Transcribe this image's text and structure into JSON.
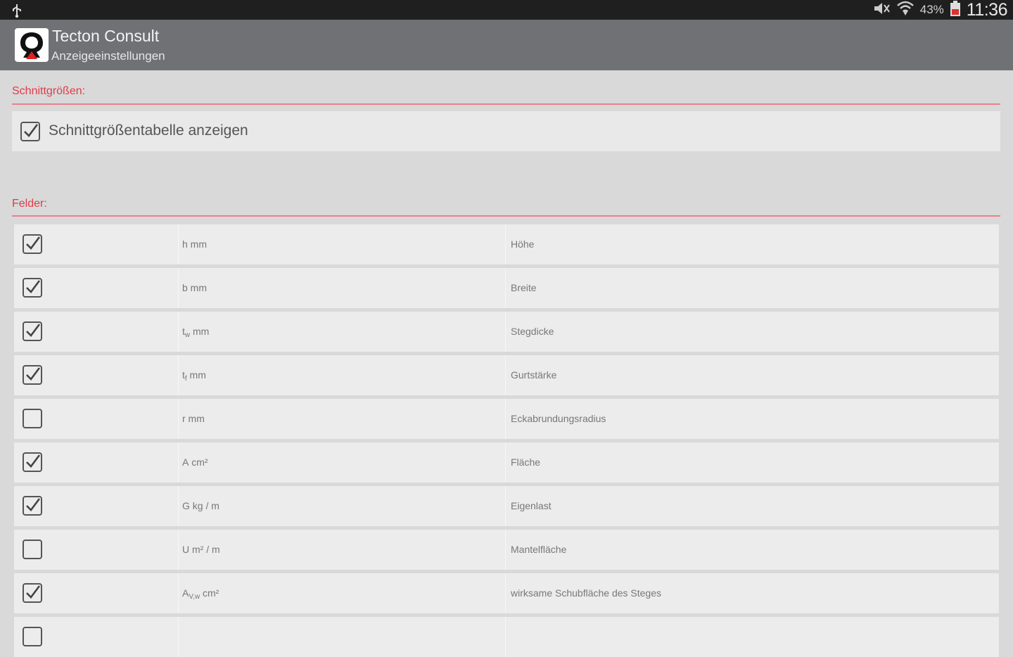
{
  "status_bar": {
    "battery_percent": "43%",
    "time": "11:36",
    "icons": [
      "usb-icon",
      "mute-icon",
      "wifi-icon",
      "battery-icon"
    ]
  },
  "action_bar": {
    "app_title": "Tecton Consult",
    "subtitle": "Anzeigeeinstellungen",
    "logo_icon": "tecton-logo-icon"
  },
  "section1": {
    "title": "Schnittgrößen:",
    "option": {
      "label": "Schnittgrößentabelle anzeigen",
      "checked": true
    }
  },
  "section2": {
    "title": "Felder:",
    "rows": [
      {
        "checked": true,
        "sym_main": "h",
        "sym_sub": "",
        "unit": " mm",
        "desc": "Höhe"
      },
      {
        "checked": true,
        "sym_main": "b",
        "sym_sub": "",
        "unit": " mm",
        "desc": "Breite"
      },
      {
        "checked": true,
        "sym_main": "t",
        "sym_sub": "w",
        "unit": " mm",
        "desc": "Stegdicke"
      },
      {
        "checked": true,
        "sym_main": "t",
        "sym_sub": "f",
        "unit": " mm",
        "desc": "Gurtstärke"
      },
      {
        "checked": false,
        "sym_main": "r",
        "sym_sub": "",
        "unit": " mm",
        "desc": "Eckabrundungsradius"
      },
      {
        "checked": true,
        "sym_main": "A",
        "sym_sub": "",
        "unit": " cm²",
        "desc": "Fläche"
      },
      {
        "checked": true,
        "sym_main": "G",
        "sym_sub": "",
        "unit": " kg / m",
        "desc": "Eigenlast"
      },
      {
        "checked": false,
        "sym_main": "U",
        "sym_sub": "",
        "unit": " m² / m",
        "desc": "Mantelfläche"
      },
      {
        "checked": true,
        "sym_main": "A",
        "sym_sub": "V,w",
        "unit": " cm²",
        "desc": "wirksame Schubfläche des Steges"
      },
      {
        "checked": false,
        "sym_main": "",
        "sym_sub": "",
        "unit": "",
        "desc": ""
      }
    ]
  }
}
